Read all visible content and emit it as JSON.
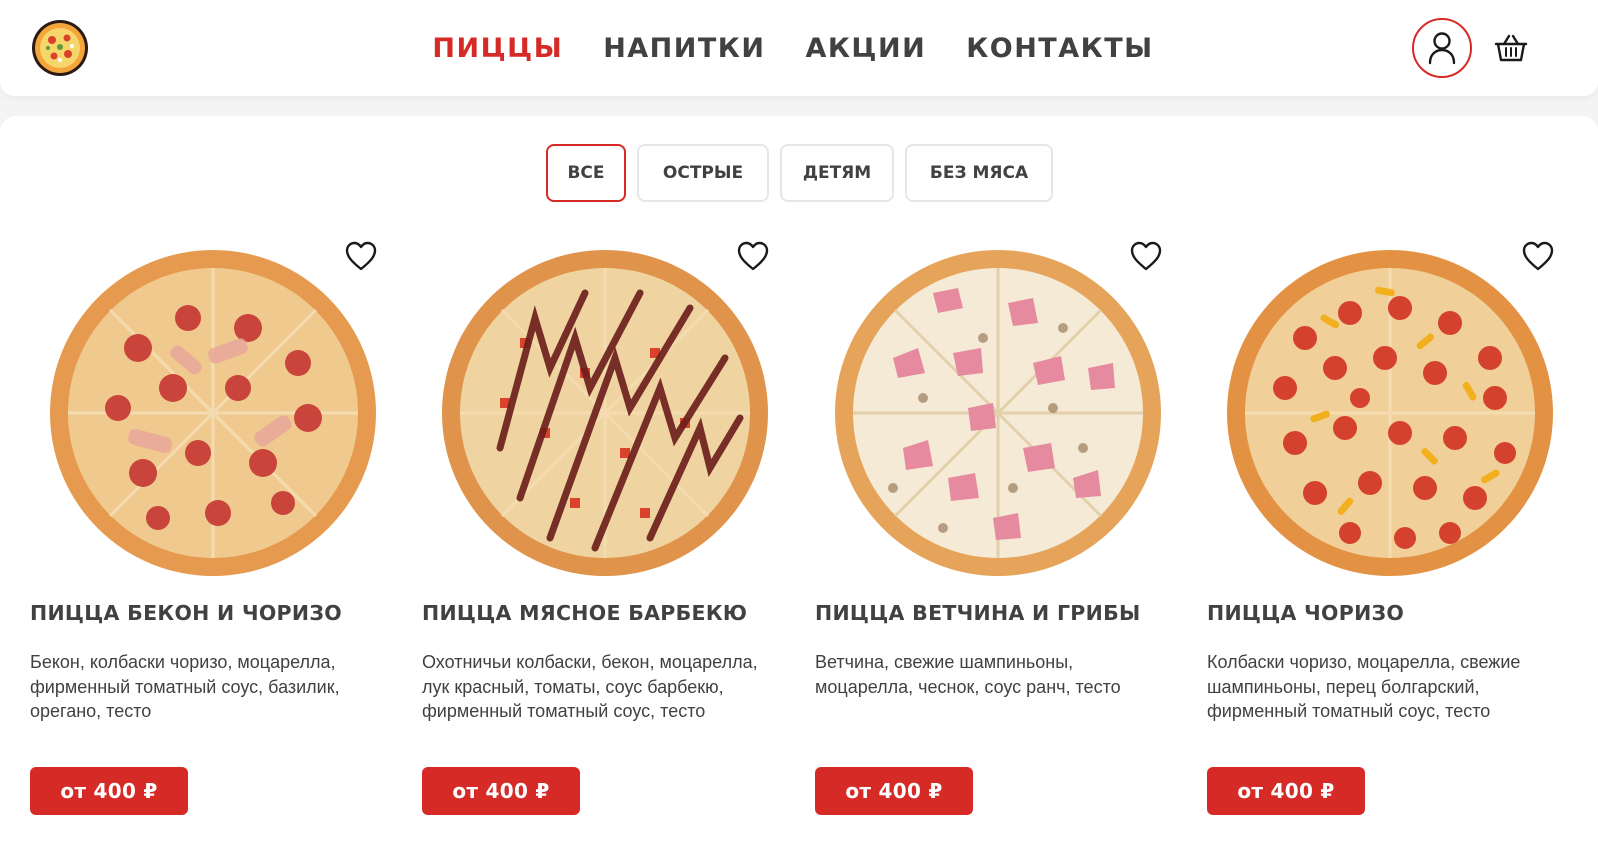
{
  "brand": {
    "accent": "#d62a27",
    "text": "#414141",
    "border": "#e6e6e6"
  },
  "header": {
    "logo_icon": "pizza-logo-icon",
    "nav": [
      {
        "label": "ПИЦЦЫ",
        "active": true
      },
      {
        "label": "НАПИТКИ",
        "active": false
      },
      {
        "label": "АКЦИИ",
        "active": false
      },
      {
        "label": "КОНТАКТЫ",
        "active": false
      }
    ],
    "user_icon": "user-icon",
    "cart_icon": "basket-icon"
  },
  "filters": [
    {
      "label": "ВСЕ",
      "active": true
    },
    {
      "label": "ОСТРЫЕ",
      "active": false
    },
    {
      "label": "ДЕТЯМ",
      "active": false
    },
    {
      "label": "БЕЗ МЯСА",
      "active": false
    }
  ],
  "products": [
    {
      "title": "ПИЦЦА БЕКОН И ЧОРИЗО",
      "description": "Бекон, колбаски чоризо, моцарелла, фирменный томатный соус, базилик, орегано, тесто",
      "price": "от 400 ₽",
      "fav_icon": "heart-icon"
    },
    {
      "title": "ПИЦЦА МЯСНОЕ БАРБЕКЮ",
      "description": "Охотничьи колбаски, бекон, моцарелла, лук красный, томаты, соус барбекю, фирменный томатный соус, тесто",
      "price": "от 400 ₽",
      "fav_icon": "heart-icon"
    },
    {
      "title": "ПИЦЦА ВЕТЧИНА И ГРИБЫ",
      "description": "Ветчина, свежие шампиньоны, моцарелла, чеснок, соус ранч, тесто",
      "price": "от 400 ₽",
      "fav_icon": "heart-icon"
    },
    {
      "title": "ПИЦЦА ЧОРИЗО",
      "description": "Колбаски чоризо, моцарелла, свежие шампиньоны, перец болгарский, фирменный томатный соус, тесто",
      "price": "от 400 ₽",
      "fav_icon": "heart-icon"
    }
  ]
}
